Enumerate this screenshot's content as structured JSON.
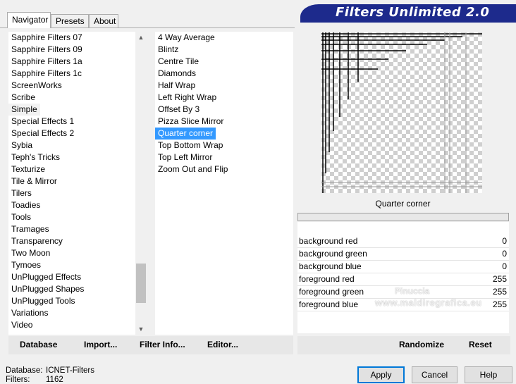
{
  "tabs": [
    "Navigator",
    "Presets",
    "About"
  ],
  "banner_title": "Filters Unlimited 2.0",
  "categories": [
    "Sapphire Filters 07",
    "Sapphire Filters 09",
    "Sapphire Filters 1a",
    "Sapphire Filters 1c",
    "ScreenWorks",
    "Scribe",
    "Simple",
    "Special Effects 1",
    "Special Effects 2",
    "Sybia",
    "Teph's Tricks",
    "Texturize",
    "Tile & Mirror",
    "Tilers",
    "Toadies",
    "Tools",
    "Tramages",
    "Transparency",
    "Two Moon",
    "Tymoes",
    "UnPlugged Effects",
    "UnPlugged Shapes",
    "UnPlugged Tools",
    "Variations",
    "Video"
  ],
  "filters": [
    "4 Way Average",
    "Blintz",
    "Centre Tile",
    "Diamonds",
    "Half Wrap",
    "Left Right Wrap",
    "Offset By 3",
    "Pizza Slice Mirror",
    "Quarter corner",
    "Top Bottom Wrap",
    "Top Left Mirror",
    "Zoom Out and Flip"
  ],
  "selected_filter": "Quarter corner",
  "params": [
    {
      "label": "background red",
      "value": "0"
    },
    {
      "label": "background green",
      "value": "0"
    },
    {
      "label": "background blue",
      "value": "0"
    },
    {
      "label": "foreground red",
      "value": "255"
    },
    {
      "label": "foreground green",
      "value": "255"
    },
    {
      "label": "foreground blue",
      "value": "255"
    }
  ],
  "left_buttons": {
    "database": "Database",
    "import": "Import...",
    "filter_info": "Filter Info...",
    "editor": "Editor..."
  },
  "right_buttons": {
    "randomize": "Randomize",
    "reset": "Reset"
  },
  "status": {
    "database_label": "Database:",
    "database_value": "ICNET-Filters",
    "filters_label": "Filters:",
    "filters_value": "1162"
  },
  "dialog_buttons": {
    "apply": "Apply",
    "cancel": "Cancel",
    "help": "Help"
  },
  "watermark": {
    "name": "Pinuccia",
    "url": "www.maldiregrafica.eu"
  }
}
